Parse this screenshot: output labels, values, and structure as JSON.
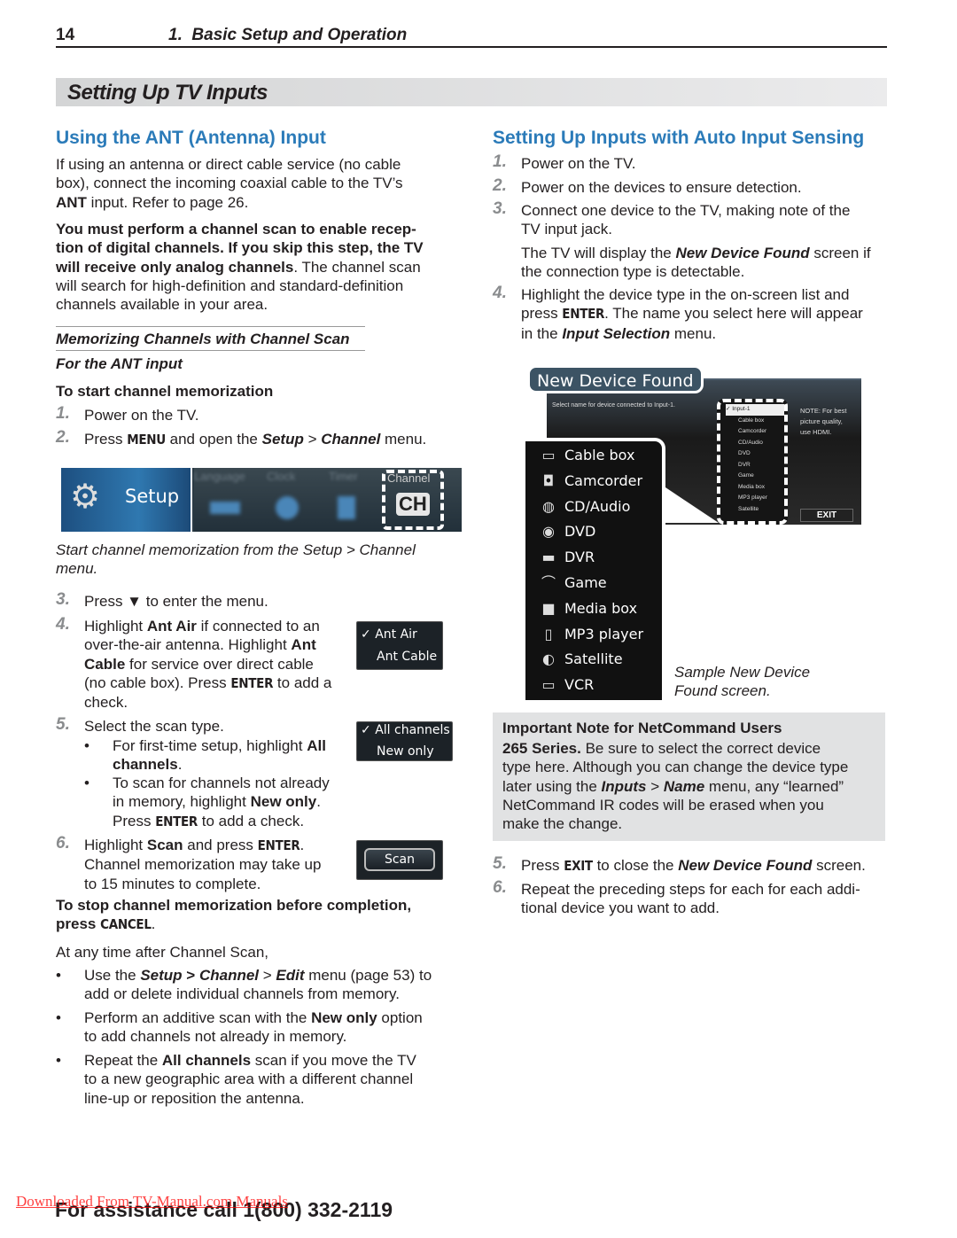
{
  "header": {
    "page_number": "14",
    "chapter": "1.  Basic Setup and Operation"
  },
  "section_title": "Setting Up TV Inputs",
  "left": {
    "heading": "Using the ANT (Antenna) Input",
    "p1": [
      "If using an antenna or direct cable service (no cable\nbox), connect the incoming coaxial cable to the TV’s\n",
      {
        "t": "ANT",
        "b": 1
      },
      " input.  Refer to page 26."
    ],
    "p2": [
      {
        "t": "You must perform a channel scan to enable recep-\ntion of digital channels.  If you skip this step, the TV\nwill receive only analog channels",
        "b": 1
      },
      ".  The channel scan\nwill search for high-definition and standard-definition\nchannels available in your area."
    ],
    "subhead": "Memorizing Channels with Channel Scan",
    "subhead2": "For the ANT input",
    "start_head": "To start channel memorization",
    "steps": [
      {
        "n": "1.",
        "text": [
          "Power on the TV."
        ]
      },
      {
        "n": "2.",
        "text": [
          "Press ",
          {
            "t": "MENU",
            "k": 1
          },
          " and open the ",
          {
            "t": "Setup",
            "b": 1,
            "i": 1
          },
          " > ",
          {
            "t": "Channel",
            "b": 1,
            "i": 1
          },
          " menu."
        ]
      },
      {
        "n": "3.",
        "text": [
          "Press ▼ to enter the menu."
        ]
      },
      {
        "n": "4.",
        "text": [
          "Highlight ",
          {
            "t": "Ant Air",
            "b": 1
          },
          " if connected to an\nover-the-air antenna.  Highlight ",
          {
            "t": "Ant\nCable",
            "b": 1
          },
          " for service over direct cable\n(no cable box).  Press ",
          {
            "t": "ENTER",
            "k": 1
          },
          " to add a\ncheck."
        ]
      },
      {
        "n": "5.",
        "text": [
          "Select the scan type."
        ]
      },
      {
        "n": "6.",
        "text": [
          "Highlight ",
          {
            "t": "Scan",
            "b": 1
          },
          " and press ",
          {
            "t": "ENTER",
            "k": 1
          },
          ".\nChannel memorization may take up\nto 15 minutes to complete."
        ]
      }
    ],
    "step5_bullets": [
      [
        "For first-time setup, highlight ",
        {
          "t": "All\nchannels",
          "b": 1
        },
        "."
      ],
      [
        "To scan for channels not already\nin memory, highlight ",
        {
          "t": "New only",
          "b": 1
        },
        ".\nPress ",
        {
          "t": "ENTER",
          "k": 1
        },
        " to add a check."
      ]
    ],
    "setup_menu": {
      "setup_label": "Setup",
      "blurred_items": [
        "Language",
        "Clock",
        "Timer"
      ],
      "channel_label": "Channel",
      "ch_icon": "CH"
    },
    "caption": "Start channel memorization from the Setup > Channel\nmenu.",
    "ant_menu": {
      "items": [
        "Ant Air",
        "Ant Cable"
      ],
      "checked": "Ant Air"
    },
    "scan_menu": {
      "items": [
        "All channels",
        "New only"
      ],
      "checked": "All channels"
    },
    "scan_button": "Scan",
    "stop": [
      {
        "t": "To stop channel memorization before completion,\npress ",
        "b": 1
      },
      {
        "t": "CANCEL",
        "k": 1
      },
      "."
    ],
    "after": "At any time after Channel Scan,",
    "after_bullets": [
      [
        "Use the ",
        {
          "t": "Setup",
          "b": 1,
          "i": 1
        },
        " ",
        {
          "t": ">",
          "b": 1
        },
        " ",
        {
          "t": "Channel",
          "b": 1,
          "i": 1
        },
        " > ",
        {
          "t": "Edit",
          "b": 1,
          "i": 1
        },
        " menu (page 53) to\nadd or delete individual channels from memory."
      ],
      [
        "Perform an additive scan with the ",
        {
          "t": "New only",
          "b": 1
        },
        " option\nto add channels not already in memory."
      ],
      [
        "Repeat the ",
        {
          "t": "All channels",
          "b": 1
        },
        " scan if you move the TV\nto a new geographic area with a different channel\nline-up or reposition the antenna."
      ]
    ]
  },
  "right": {
    "heading": "Setting Up Inputs with Auto Input Sensing",
    "steps": [
      {
        "n": "1.",
        "text": [
          "Power on the TV."
        ]
      },
      {
        "n": "2.",
        "text": [
          "Power on the devices to ensure detection."
        ]
      },
      {
        "n": "3.",
        "text": [
          "Connect one device to the TV, making note of the\nTV input jack."
        ]
      },
      {
        "n": "4.",
        "text": [
          "Highlight the device type in the on-screen list and\npress ",
          {
            "t": "ENTER",
            "k": 1
          },
          ".  The name you select here will appear\nin the ",
          {
            "t": "Input Selection",
            "b": 1,
            "i": 1
          },
          " menu."
        ]
      },
      {
        "n": "5.",
        "text": [
          "Press ",
          {
            "t": "EXIT",
            "k": 1
          },
          " to close the ",
          {
            "t": "New Device Found",
            "b": 1,
            "i": 1
          },
          " screen."
        ]
      },
      {
        "n": "6.",
        "text": [
          "Repeat the preceding steps for each for each addi-\ntional device you want to add."
        ]
      }
    ],
    "step3_note": [
      "The TV will display the ",
      {
        "t": "New Device Found",
        "b": 1,
        "i": 1
      },
      " screen if\nthe connection type is detectable."
    ],
    "screen": {
      "title": "New Device Found",
      "prompt": "Select name for device connected to Input-1.",
      "note": "NOTE: For best\npicture quality,\nuse HDMI.",
      "exit": "EXIT",
      "small_list": [
        "Input-1",
        "Cable box",
        "Camcorder",
        "CD/Audio",
        "DVD",
        "DVR",
        "Game",
        "Media box",
        "MP3 player",
        "Satellite"
      ],
      "big_list": [
        {
          "label": "Cable box",
          "icon": "cable-box-icon"
        },
        {
          "label": "Camcorder",
          "icon": "camcorder-icon"
        },
        {
          "label": "CD/Audio",
          "icon": "cd-audio-icon"
        },
        {
          "label": "DVD",
          "icon": "dvd-icon"
        },
        {
          "label": "DVR",
          "icon": "dvr-icon"
        },
        {
          "label": "Game",
          "icon": "game-icon"
        },
        {
          "label": "Media box",
          "icon": "media-box-icon"
        },
        {
          "label": "MP3 player",
          "icon": "mp3-player-icon"
        },
        {
          "label": "Satellite",
          "icon": "satellite-icon"
        },
        {
          "label": "VCR",
          "icon": "vcr-icon"
        }
      ]
    },
    "screen_caption": "Sample New Device\nFound screen.",
    "note_box": {
      "title": "Important Note for NetCommand Users",
      "body": [
        {
          "t": "265 Series.",
          "b": 1
        },
        "  Be sure to select the correct device\ntype here.  Although you can change the device type\nlater using the ",
        {
          "t": "Inputs",
          "b": 1,
          "i": 1
        },
        " > ",
        {
          "t": "Name",
          "b": 1,
          "i": 1
        },
        " menu, any “learned”\nNetCommand IR codes will be erased when you\nmake the change."
      ]
    }
  },
  "footer": {
    "assist": "For assistance call 1(800) 332-2119",
    "watermark": "Downloaded From TV-Manual.com Manuals"
  },
  "colors": {
    "heading": "#2b7bb9",
    "title_bar": "#dcddde",
    "note_box": "#e1e2e3",
    "watermark": "#ff0000"
  }
}
